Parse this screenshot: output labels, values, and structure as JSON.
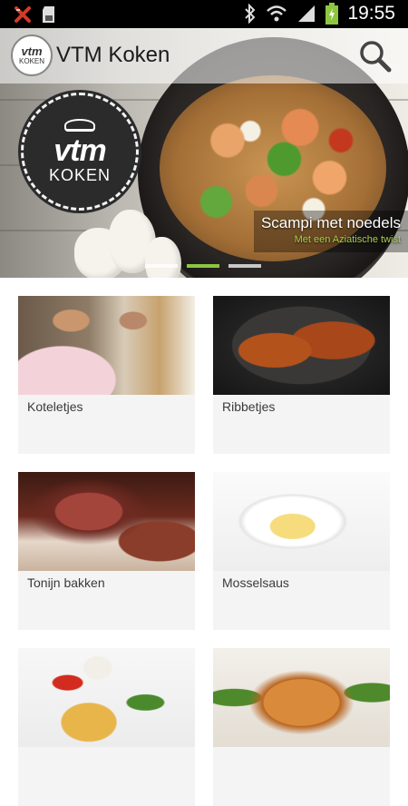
{
  "status_bar": {
    "time": "19:55",
    "icons": [
      "no-sim-icon",
      "sd-card-icon",
      "bluetooth-icon",
      "wifi-icon",
      "signal-icon",
      "battery-charging-icon"
    ]
  },
  "app_bar": {
    "logo_line1": "vtm",
    "logo_line2": "KOKEN",
    "title": "VTM Koken",
    "search_icon": "search-icon"
  },
  "hero": {
    "badge_line1": "vtm",
    "badge_line2": "KOKEN",
    "title": "Scampi met noedels",
    "subtitle": "Met een Aziatische twist",
    "pages": 3,
    "active_page": 2
  },
  "recipes": [
    {
      "label": "Koteletjes"
    },
    {
      "label": "Ribbetjes"
    },
    {
      "label": "Tonijn bakken"
    },
    {
      "label": "Mosselsaus"
    },
    {
      "label": ""
    },
    {
      "label": ""
    }
  ],
  "colors": {
    "accent": "#8dc63f",
    "subtitle": "#a8cf45"
  }
}
